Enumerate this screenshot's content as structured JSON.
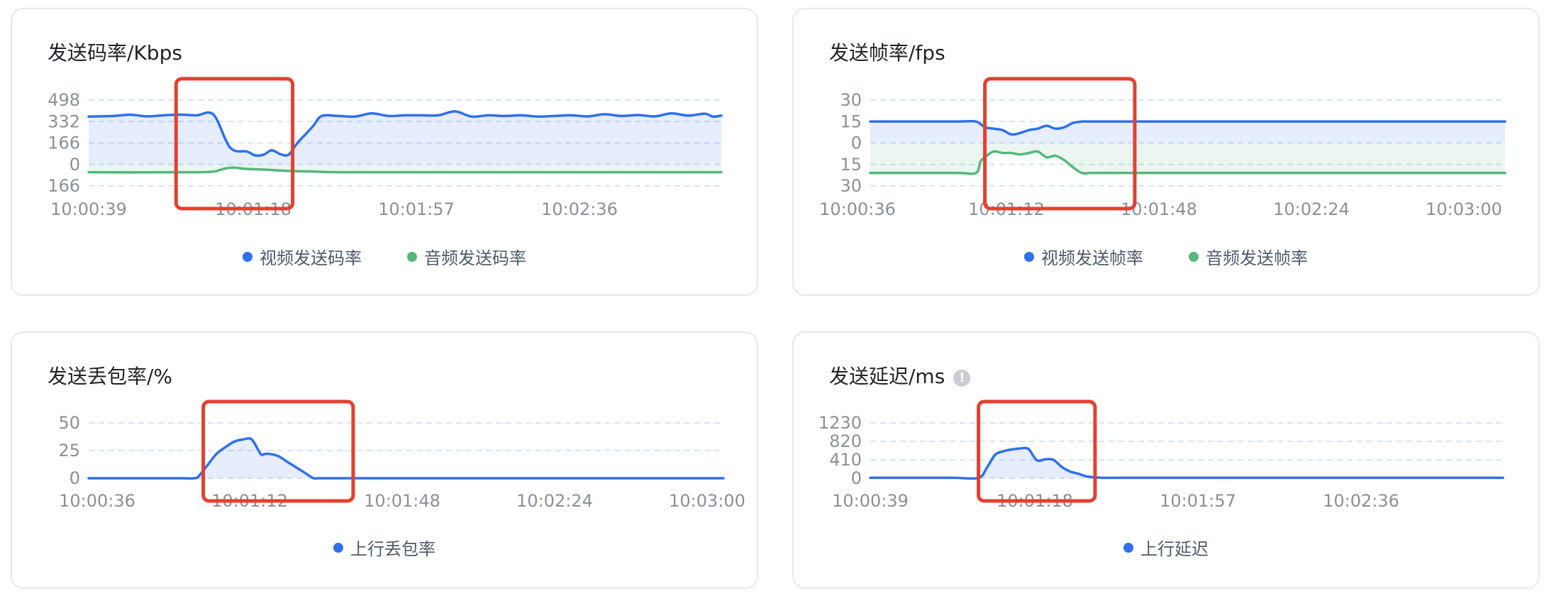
{
  "colors": {
    "video": "#2f6ff0",
    "audio": "#53b87a",
    "highlight": "#e4402f",
    "grid": "#d6e4f5"
  },
  "panels": [
    {
      "id": "bitrate",
      "title": "发送码率/Kbps",
      "legend": [
        {
          "label": "视频发送码率",
          "color": "#2f6ff0"
        },
        {
          "label": "音频发送码率",
          "color": "#53b87a"
        }
      ],
      "y_ticks": [
        "498",
        "332",
        "166",
        "0",
        "166"
      ],
      "x_ticks": [
        "10:00:39",
        "10:01:18",
        "10:01:57",
        "10:02:36"
      ]
    },
    {
      "id": "framerate",
      "title": "发送帧率/fps",
      "legend": [
        {
          "label": "视频发送帧率",
          "color": "#2f6ff0"
        },
        {
          "label": "音频发送帧率",
          "color": "#53b87a"
        }
      ],
      "y_ticks": [
        "30",
        "15",
        "0",
        "15",
        "30"
      ],
      "x_ticks": [
        "10:00:36",
        "10:01:12",
        "10:01:48",
        "10:02:24",
        "10:03:00"
      ]
    },
    {
      "id": "loss",
      "title": "发送丢包率/%",
      "legend": [
        {
          "label": "上行丢包率",
          "color": "#2f6ff0"
        }
      ],
      "y_ticks": [
        "50",
        "25",
        "0"
      ],
      "x_ticks": [
        "10:00:36",
        "10:01:12",
        "10:01:48",
        "10:02:24",
        "10:03:00"
      ]
    },
    {
      "id": "delay",
      "title": "发送延迟/ms",
      "info_icon": "info-icon",
      "legend": [
        {
          "label": "上行延迟",
          "color": "#2f6ff0"
        }
      ],
      "y_ticks": [
        "1230",
        "820",
        "410",
        "0"
      ],
      "x_ticks": [
        "10:00:39",
        "10:01:18",
        "10:01:57",
        "10:02:36"
      ]
    }
  ],
  "chart_data": [
    {
      "type": "area",
      "title": "发送码率/Kbps",
      "x_range": [
        "10:00:39",
        "10:03:12"
      ],
      "ylim": [
        -166,
        498
      ],
      "grid": true,
      "legend_position": "bottom",
      "highlight_x_range": [
        "10:01:00",
        "10:01:28"
      ],
      "series": [
        {
          "name": "视频发送码率",
          "color": "#2f6ff0",
          "x": [
            0,
            6,
            10,
            14,
            18,
            22,
            26,
            30,
            34,
            38,
            40,
            42,
            44,
            46,
            48,
            50,
            52,
            54,
            56,
            60,
            64,
            68,
            72,
            76,
            80,
            84,
            88,
            92,
            96,
            100,
            104,
            108,
            112,
            116,
            120,
            124,
            128,
            132,
            136,
            140,
            144,
            148,
            150,
            152
          ],
          "values": [
            370,
            375,
            385,
            372,
            380,
            385,
            380,
            385,
            130,
            100,
            70,
            75,
            110,
            80,
            75,
            160,
            230,
            300,
            375,
            375,
            370,
            395,
            375,
            380,
            380,
            380,
            410,
            370,
            380,
            375,
            380,
            370,
            375,
            380,
            372,
            388,
            375,
            382,
            372,
            395,
            378,
            392,
            370,
            378
          ]
        },
        {
          "name": "音频发送码率",
          "color": "#53b87a",
          "x": [
            0,
            10,
            20,
            26,
            30,
            33,
            35,
            38,
            42,
            48,
            54,
            60,
            80,
            100,
            120,
            140,
            152
          ],
          "values": [
            -60,
            -62,
            -60,
            -60,
            -55,
            -30,
            -25,
            -35,
            -40,
            -50,
            -55,
            -60,
            -60,
            -60,
            -60,
            -60,
            -60
          ]
        }
      ]
    },
    {
      "type": "area",
      "title": "发送帧率/fps",
      "x_range": [
        "10:00:36",
        "10:03:00"
      ],
      "ylim": [
        -30,
        30
      ],
      "grid": true,
      "legend_position": "bottom",
      "highlight_x_range": [
        "10:01:02",
        "10:01:36"
      ],
      "series": [
        {
          "name": "视频发送帧率",
          "color": "#2f6ff0",
          "x": [
            0,
            10,
            20,
            24,
            26,
            28,
            30,
            32,
            34,
            36,
            38,
            40,
            42,
            44,
            46,
            48,
            50,
            52,
            56,
            60,
            80,
            100,
            120,
            144
          ],
          "values": [
            15,
            15,
            15,
            15,
            11,
            10,
            9,
            6,
            7,
            9,
            10,
            12,
            10,
            11,
            14,
            15,
            15,
            15,
            15,
            15,
            15,
            15,
            15,
            15
          ]
        },
        {
          "name": "音频发送帧率",
          "color": "#53b87a",
          "x": [
            0,
            10,
            20,
            24,
            25,
            26,
            28,
            30,
            32,
            34,
            36,
            38,
            40,
            42,
            44,
            46,
            48,
            50,
            52,
            56,
            60,
            80,
            100,
            120,
            144
          ],
          "values": [
            -21,
            -21,
            -21,
            -21,
            -13,
            -10,
            -6,
            -7,
            -7,
            -8,
            -7,
            -6,
            -10,
            -9,
            -12,
            -17,
            -21,
            -21,
            -21,
            -21,
            -21,
            -21,
            -21,
            -21,
            -21
          ]
        }
      ]
    },
    {
      "type": "area",
      "title": "发送丢包率/%",
      "x_range": [
        "10:00:36",
        "10:03:00"
      ],
      "ylim": [
        0,
        50
      ],
      "grid": true,
      "legend_position": "bottom",
      "highlight_x_range": [
        "10:01:02",
        "10:01:36"
      ],
      "series": [
        {
          "name": "上行丢包率",
          "color": "#2f6ff0",
          "x": [
            0,
            10,
            20,
            24,
            25,
            27,
            29,
            31,
            33,
            35,
            37,
            39,
            40,
            41,
            43,
            45,
            47,
            49,
            51,
            52,
            56,
            80,
            100,
            120,
            144
          ],
          "values": [
            0,
            0,
            0,
            0,
            2,
            12,
            22,
            28,
            33,
            35,
            35,
            22,
            22,
            22,
            20,
            15,
            10,
            5,
            0,
            0,
            0,
            0,
            0,
            0,
            0
          ]
        }
      ]
    },
    {
      "type": "area",
      "title": "发送延迟/ms",
      "x_range": [
        "10:00:39",
        "10:03:12"
      ],
      "ylim": [
        0,
        1230
      ],
      "grid": true,
      "legend_position": "bottom",
      "highlight_x_range": [
        "10:01:05",
        "10:01:33"
      ],
      "series": [
        {
          "name": "上行延迟",
          "color": "#2f6ff0",
          "x": [
            0,
            10,
            20,
            26,
            28,
            30,
            32,
            34,
            36,
            38,
            40,
            42,
            44,
            46,
            48,
            50,
            52,
            54,
            56,
            60,
            80,
            100,
            120,
            140,
            152
          ],
          "values": [
            10,
            10,
            10,
            10,
            230,
            520,
            600,
            640,
            660,
            650,
            400,
            420,
            410,
            250,
            150,
            100,
            40,
            20,
            10,
            10,
            10,
            10,
            10,
            10,
            10
          ]
        }
      ]
    }
  ]
}
